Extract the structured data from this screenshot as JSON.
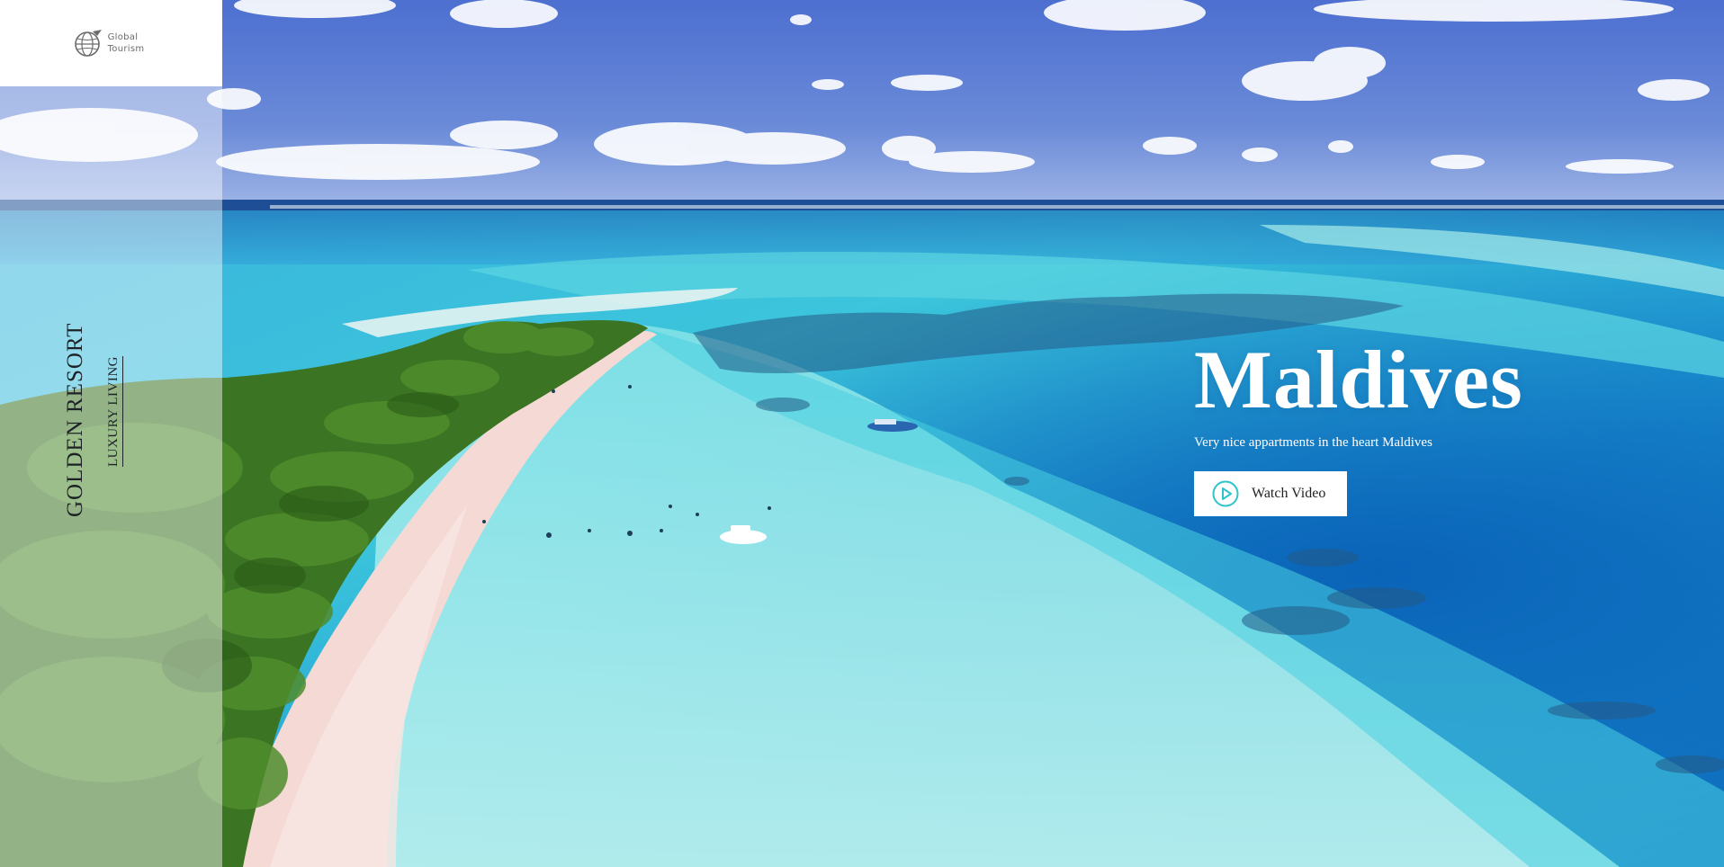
{
  "brand": {
    "logo_line1": "Global",
    "logo_line2": "Tourism",
    "resort_name": "GOLDEN RESORT",
    "tagline": "LUXURY LIVING"
  },
  "hero": {
    "title": "Maldives",
    "subtitle": "Very nice appartments in the heart Maldives",
    "cta_label": "Watch Video",
    "cta_icon": "play-circle-icon"
  },
  "colors": {
    "accent": "#2ec4c9",
    "sky": "#5a7fd4",
    "lagoon": "#6fd8e0",
    "ocean": "#1578c4",
    "sand": "#f4d9d5",
    "foliage": "#3f7a26"
  }
}
